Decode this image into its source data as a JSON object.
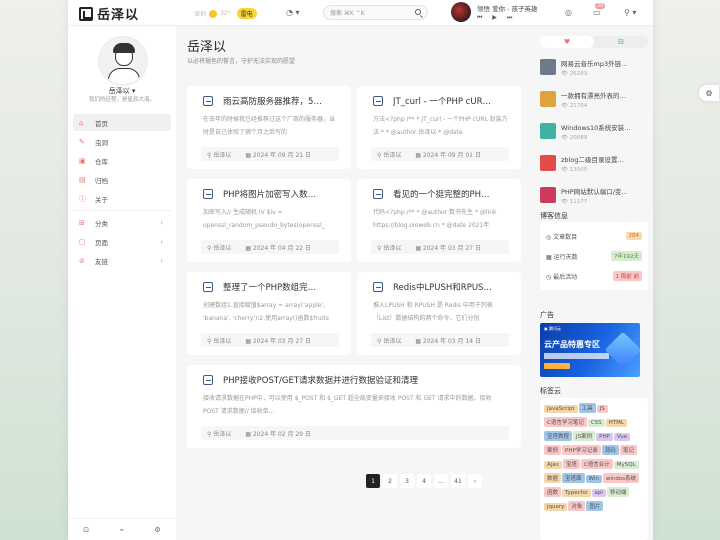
{
  "header": {
    "logo_text": "岳泽以",
    "weather_city": "深圳",
    "weather_temp": "32°",
    "weather_badge": "雷电",
    "search_placeholder": "搜索 ⌘K ⌃K",
    "music_title": "领悟 爱你 - 孩子英雄",
    "music_controls": "⏮ ▶ ⏭",
    "notify_count": "20"
  },
  "profile": {
    "name": "岳泽以 ▾",
    "motto": "我们的征程，是星辰大海。"
  },
  "nav": [
    {
      "icon": "⌂",
      "label": "首页",
      "active": true
    },
    {
      "icon": "✎",
      "label": "虫洞"
    },
    {
      "icon": "▣",
      "label": "仓库"
    },
    {
      "icon": "▤",
      "label": "归档"
    },
    {
      "icon": "ⓘ",
      "label": "关于"
    },
    {
      "icon": "⊞",
      "label": "分类",
      "chev": "›"
    },
    {
      "icon": "▢",
      "label": "页面",
      "chev": "›"
    },
    {
      "icon": "⊘",
      "label": "友链",
      "chev": "›"
    }
  ],
  "sidebar_footer": [
    "⊡",
    "⌁",
    "⚙"
  ],
  "main": {
    "title": "岳泽以",
    "subtitle": "以必将褪色的誓言，守护无法实现的愿望"
  },
  "posts": [
    {
      "title": "雨云高防服务器推荐，5…",
      "excerpt": "在去年的时候我已经推荐过这个厂商的服务器，当时是自己体验了俩个月之后写的",
      "author": "岳泽以",
      "date": "2024 年 09 月 21 日"
    },
    {
      "title": "JT_curl - 一个PHP cUR…",
      "excerpt": "方法<?php /** * JT_curl - 一个PHP cURL 封装方法 * * @author 岳泽以 * @date",
      "author": "岳泽以",
      "date": "2024 年 09 月 01 日"
    },
    {
      "title": "PHP将图片加密写入数…",
      "excerpt": "加密写入// 生成随机 IV $iv = openssl_random_pseudo_bytes(openssl_",
      "author": "岳泽以",
      "date": "2024 年 04 月 22 日"
    },
    {
      "title": "看见的一个挺完整的PH…",
      "excerpt": "代码<?php /** * @author 数书先生 * @link https://blog.oioweb.cn * @date 2021年",
      "author": "岳泽以",
      "date": "2024 年 03 月 27 日"
    },
    {
      "title": "整理了一个PHP数组完…",
      "excerpt": "创建数组1.直接赋值$array = array('apple', 'banana', 'cherry');2.使用array()函数$fruits",
      "author": "岳泽以",
      "date": "2024 年 03 月 27 日"
    },
    {
      "title": "Redis中LPUSH和RPUS…",
      "excerpt": "推入LPUSH 和 RPUSH 是 Redis 中用于列表（List）数据结构的两个命令，它们分别",
      "author": "岳泽以",
      "date": "2024 年 03 月 14 日"
    },
    {
      "title": "PHP接收POST/GET请求数据并进行数据验证和清理",
      "excerpt": "接收请求数据在PHP中，可以使用 $_POST 和 $_GET 超全局变量来接收 POST 和 GET 请求中的数据。接收 POST 请求数据// 接收单…",
      "author": "岳泽以",
      "date": "2024 年 02 月 29 日"
    }
  ],
  "pagination": [
    "1",
    "2",
    "3",
    "4",
    "…",
    "41",
    "›"
  ],
  "right": {
    "tabs": [
      "♥",
      "⊟"
    ],
    "hot": [
      {
        "title": "网易云音乐mp3外链…",
        "views": "👁 26283",
        "color": "#6c7a8a"
      },
      {
        "title": "一款拥有漂亮外表的…",
        "views": "👁 21704",
        "color": "#e0a23a"
      },
      {
        "title": "Windows10系统安装…",
        "views": "👁 20089",
        "color": "#3fb2a6"
      },
      {
        "title": "zblog二级目录设置…",
        "views": "👁 13505",
        "color": "#e44c4c"
      },
      {
        "title": "PHP网站默认端口/变…",
        "views": "👁 11177",
        "color": "#cc3b5c"
      }
    ],
    "stats_title": "博客信息",
    "stats": [
      {
        "label": "文章数目",
        "icon": "◎",
        "value": "284",
        "bg": "#f9d9b0",
        "fg": "#c97a20"
      },
      {
        "label": "运行天数",
        "icon": "▦",
        "value": "7年192天",
        "bg": "#d9ecd2",
        "fg": "#4e8a3e"
      },
      {
        "label": "最后活动",
        "icon": "◷",
        "value": "1 周前 前",
        "bg": "#f9c7c7",
        "fg": "#c44"
      }
    ],
    "ad_title": "广告",
    "ad_logo": "▣ 腾讯云",
    "ad_headline": "云产品特惠专区",
    "tags_title": "标签云",
    "tags": [
      {
        "t": "JavaScript",
        "c": "#f4d6a8"
      },
      {
        "t": "工具",
        "c": "#9fc6e8"
      },
      {
        "t": "JS",
        "c": "#f9c7c7"
      },
      {
        "t": "C语言学习笔记",
        "c": "#f9c7c7"
      },
      {
        "t": "CSS",
        "c": "#d9ecd2"
      },
      {
        "t": "HTML",
        "c": "#f4d6a8"
      },
      {
        "t": "宝塔教程",
        "c": "#9fc6e8"
      },
      {
        "t": "JS案例",
        "c": "#d9ecd2"
      },
      {
        "t": "PHP",
        "c": "#d8c7f0"
      },
      {
        "t": "Vue",
        "c": "#d8c7f0"
      },
      {
        "t": "案例",
        "c": "#f9c7c7"
      },
      {
        "t": "PHP学习记录",
        "c": "#f9c7c7"
      },
      {
        "t": "源码",
        "c": "#9fc6e8"
      },
      {
        "t": "笔记",
        "c": "#f9c7c7"
      },
      {
        "t": "Ajax",
        "c": "#f4d6a8"
      },
      {
        "t": "宝塔",
        "c": "#f9c7c7"
      },
      {
        "t": "C语言合计",
        "c": "#f9c7c7"
      },
      {
        "t": "MySQL",
        "c": "#d9ecd2"
      },
      {
        "t": "数据",
        "c": "#f4d6a8"
      },
      {
        "t": "宝塔面",
        "c": "#9fc6e8"
      },
      {
        "t": "Win",
        "c": "#9fc6e8"
      },
      {
        "t": "windos系统",
        "c": "#f9c7c7"
      },
      {
        "t": "函数",
        "c": "#f9c7c7"
      },
      {
        "t": "Typecho",
        "c": "#f4d6a8"
      },
      {
        "t": "api",
        "c": "#d8c7f0"
      },
      {
        "t": "移动端",
        "c": "#d9ecd2"
      },
      {
        "t": "jquery",
        "c": "#f4d6a8"
      },
      {
        "t": "对象",
        "c": "#f9c7c7"
      },
      {
        "t": "图片",
        "c": "#9fc6e8"
      }
    ]
  },
  "float_button": "⚙"
}
